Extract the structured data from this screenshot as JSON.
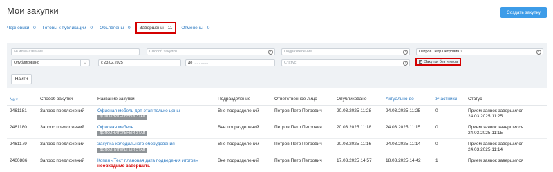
{
  "page": {
    "title": "Мои закупки",
    "create_button": "Создать закупку"
  },
  "tabs": [
    {
      "label": "Черновики - 0"
    },
    {
      "label": "Готовы к публикации - 0"
    },
    {
      "label": "Объявлены - 0"
    },
    {
      "label": "Завершены - 11",
      "active": true
    },
    {
      "label": "Отменены - 0"
    }
  ],
  "filters": {
    "number_placeholder": "№ или название",
    "method_placeholder": "Способ закупки",
    "department_placeholder": "Подразделение",
    "person_value": "Петров Петр Петрович",
    "published_select": "Опубликовано",
    "date_from_prefix": "с",
    "date_from": "23.02.2025",
    "date_to_prefix": "до",
    "date_to": "..............",
    "status_placeholder": "Статус",
    "no_results_checkbox": "Закупки без итогов",
    "find_button": "Найти"
  },
  "table": {
    "headers": [
      "№ ▾",
      "Способ закупки",
      "Название закупки",
      "Подразделение",
      "Ответственное лицо",
      "Опубликовано",
      "Актуально до",
      "Участники",
      "Статус"
    ],
    "rows": [
      {
        "num": "2461181",
        "method": "Запрос предложений",
        "name": "Офисная мебель доп этап только цены",
        "badge": "ДОПОЛНИТЕЛЬНЫЙ ЭТАП",
        "dept": "Вне подразделений",
        "person": "Петров Петр Петрович",
        "published": "20.03.2025 11:28",
        "until": "24.03.2025 11:25",
        "participants": "0",
        "status": "Прием заявок завершился",
        "status2": "24.03.2025 11:25"
      },
      {
        "num": "2461180",
        "method": "Запрос предложений",
        "name": "Офисная мебель",
        "badge": "ДОПОЛНИТЕЛЬНЫЙ ЭТАП",
        "dept": "Вне подразделений",
        "person": "Петров Петр Петрович",
        "published": "20.03.2025 11:18",
        "until": "24.03.2025 11:15",
        "participants": "0",
        "status": "Прием заявок завершился",
        "status2": "24.03.2025 11:15"
      },
      {
        "num": "2461179",
        "method": "Запрос предложений",
        "name": "Закупка холодильного оборудования",
        "badge": "ДОПОЛНИТЕЛЬНЫЙ ЭТАП",
        "dept": "Вне подразделений",
        "person": "Петров Петр Петрович",
        "published": "20.03.2025 11:16",
        "until": "24.03.2025 11:14",
        "participants": "0",
        "status": "Прием заявок завершился",
        "status2": "24.03.2025 11:14"
      },
      {
        "num": "2460886",
        "method": "Запрос предложений",
        "name": "Копия «Тест плановая дата подведения итогов»",
        "warning": "необходимо завершить",
        "dept": "Вне подразделений",
        "person": "Петров Петр Петрович",
        "published": "17.03.2025 14:57",
        "until": "18.03.2025 14:42",
        "participants": "1",
        "status": "Прием заявок завершился",
        "status2": ""
      }
    ]
  },
  "colors": {
    "accent": "#3d9ce8",
    "link": "#2a78c0",
    "highlight": "#d40000",
    "badge": "#8f9498",
    "panel": "#eff2f5"
  }
}
